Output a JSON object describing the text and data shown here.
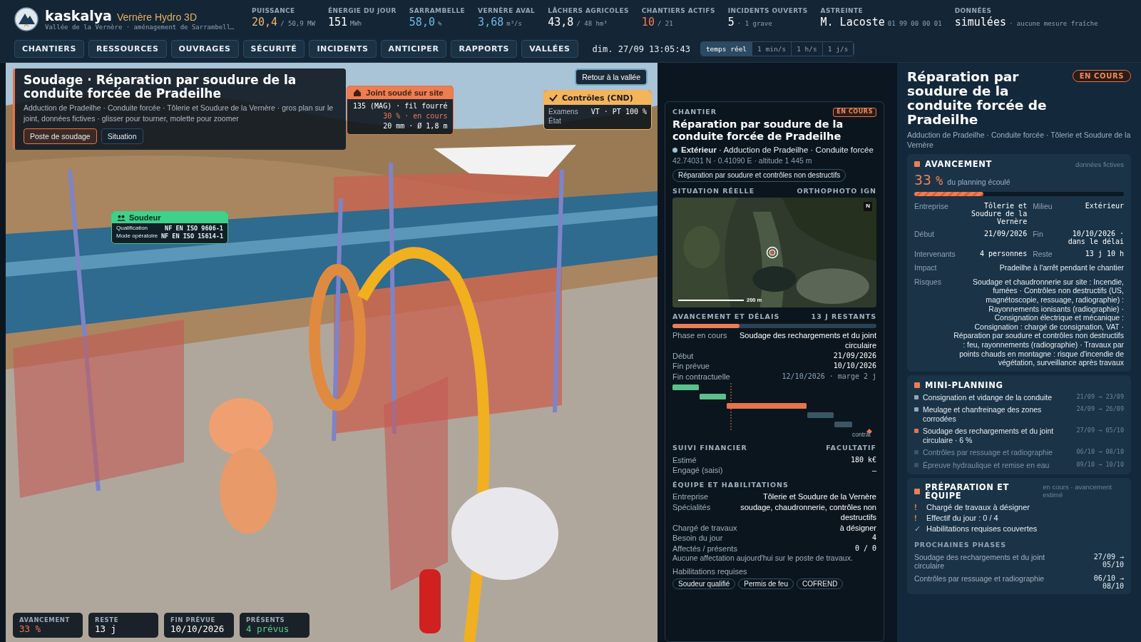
{
  "brand": {
    "name": "kaskalya",
    "product": "Vernère Hydro 3D",
    "subtitle": "Vallée de la Vernère · aménagement de Sarrambell…"
  },
  "kpis": [
    {
      "label": "PUISSANCE",
      "value": "20,4",
      "unit": "/ 50,9 MW",
      "color": "#f2b36b"
    },
    {
      "label": "ÉNERGIE DU JOUR",
      "value": "151",
      "unit": "MWh",
      "color": "#ffffff"
    },
    {
      "label": "SARRAMBELLE",
      "value": "58,0",
      "unit": "%",
      "color": "#6fb9e6"
    },
    {
      "label": "VERNÈRE AVAL",
      "value": "3,68",
      "unit": "m³/s",
      "color": "#6fb9e6"
    },
    {
      "label": "LÂCHERS AGRICOLES",
      "value": "43,8",
      "unit": "/ 48 hm³",
      "color": "#ffffff"
    },
    {
      "label": "CHANTIERS ACTIFS",
      "value": "10",
      "unit": "/ 21",
      "color": "#f07b55"
    },
    {
      "label": "INCIDENTS OUVERTS",
      "value": "5",
      "unit": "· 1 grave",
      "color": "#ffffff"
    },
    {
      "label": "ASTREINTE",
      "value": "M. Lacoste",
      "unit": "01 99 00 00 01",
      "color": "#ffffff"
    },
    {
      "label": "DONNÉES",
      "value": "simulées",
      "unit": "· aucune mesure fraîche",
      "color": "#ffffff"
    }
  ],
  "nav": {
    "tabs": [
      {
        "label": "CHANTIERS",
        "selected": false
      },
      {
        "label": "RESSOURCES",
        "selected": false
      },
      {
        "label": "OUVRAGES",
        "selected": false
      },
      {
        "label": "SÉCURITÉ",
        "selected": false
      },
      {
        "label": "INCIDENTS",
        "selected": false
      },
      {
        "label": "ANTICIPER",
        "selected": false
      },
      {
        "label": "RAPPORTS",
        "selected": false
      },
      {
        "label": "VALLÉES",
        "selected": false
      }
    ],
    "clock": "dim. 27/09 13:05:43",
    "speeds": [
      {
        "label": "temps réel",
        "selected": true
      },
      {
        "label": "1 min/s",
        "selected": false
      },
      {
        "label": "1 h/s",
        "selected": false
      },
      {
        "label": "1 j/s",
        "selected": false
      }
    ]
  },
  "scene": {
    "title_card": {
      "title": "Soudage · Réparation par soudure de la conduite forcée de Pradeilhe",
      "subtitle": "Adduction de Pradeilhe · Conduite forcée · Tôlerie et Soudure de la Vernère · gros plan sur le joint, données fictives · glisser pour tourner, molette pour zoomer",
      "buttons": [
        {
          "label": "Poste de soudage",
          "selected": true
        },
        {
          "label": "Situation",
          "selected": false
        }
      ]
    },
    "return_button": "Retour à la vallée",
    "weld_label": {
      "title": "Joint soudé sur site",
      "rows": [
        {
          "value": "135 (MAG) · fil fourré",
          "kind": "plain"
        },
        {
          "value": "30 % · en cours",
          "kind": "alert"
        },
        {
          "value": "20 mm · Ø 1,8 m",
          "kind": "plain"
        }
      ]
    },
    "control_label": {
      "title": "Contrôles (CND)",
      "rows": [
        {
          "label": "Examens",
          "value": "VT · PT 100 %"
        },
        {
          "label": "État"
        }
      ]
    },
    "welder_label": {
      "title": "Soudeur",
      "rows": [
        {
          "label": "Qualification",
          "value": "NF EN ISO 9606-1"
        },
        {
          "label": "Mode opératoire",
          "value": "NF EN ISO 15614-1"
        }
      ]
    },
    "stats": [
      {
        "label": "AVANCEMENT",
        "value": "33 %",
        "color": "#f07b55"
      },
      {
        "label": "RESTE",
        "value": "13 j",
        "color": "#ffffff"
      },
      {
        "label": "FIN PRÉVUE",
        "value": "10/10/2026",
        "color": "#ffffff"
      },
      {
        "label": "PRÉSENTS",
        "value": "4 prévus",
        "color": "#4fd18b"
      }
    ]
  },
  "site_card": {
    "section": "CHANTIER",
    "badge": "EN COURS",
    "title": "Réparation par soudure de la conduite forcée de Pradeilhe",
    "location": "**Extérieur** · Adduction de Pradeilhe · Conduite forcée",
    "coords": "42.74031 N · 0.41090 E · altitude 1 445 m",
    "tag": "Réparation par soudure et contrôles non destructifs",
    "map": {
      "heading": "SITUATION RÉELLE",
      "source": "ORTHOPHOTO IGN",
      "north": "N",
      "scale": "200 m"
    },
    "progress": {
      "heading": "AVANCEMENT ET DÉLAIS",
      "remaining": "13 J RESTANTS",
      "level": 0.33,
      "rows": [
        {
          "label": "Phase en cours",
          "value": "Soudage des rechargements et du joint circulaire",
          "kind": "text"
        },
        {
          "label": "Début",
          "value": "21/09/2026",
          "kind": "date"
        },
        {
          "label": "Fin prévue",
          "value": "10/10/2026",
          "kind": "date"
        },
        {
          "label": "Fin contractuelle",
          "value": "12/10/2026 · marge 2 j",
          "kind": "muted"
        }
      ],
      "contract_label": "contrat"
    },
    "finance": {
      "heading": "SUIVI FINANCIER",
      "note": "FACULTATIF",
      "rows": [
        {
          "label": "Estimé",
          "value": "180 k€",
          "kind": "date"
        },
        {
          "label": "Engagé (saisi)",
          "value": "–",
          "kind": "text"
        }
      ]
    },
    "team": {
      "heading": "ÉQUIPE ET HABILITATIONS",
      "rows": [
        {
          "label": "Entreprise",
          "value": "Tôlerie et Soudure de la Vernère",
          "kind": "text"
        },
        {
          "label": "Spécialités",
          "value": "soudage, chaudronnerie, contrôles non destructifs",
          "kind": "text"
        },
        {
          "label": "Chargé de travaux",
          "value": "à désigner",
          "kind": "text"
        },
        {
          "label": "Besoin du jour",
          "value": "4",
          "kind": "date"
        },
        {
          "label": "Affectés / présents",
          "value": "0 / 0",
          "kind": "date"
        }
      ],
      "note": "Aucune affectation aujourd'hui sur le poste de travaux.",
      "habilitations_label": "Habilitations requises",
      "chips": [
        "Soudeur qualifié",
        "Permis de feu",
        "COFREND"
      ]
    }
  },
  "detail_panel": {
    "title": "Réparation par soudure de la conduite forcée de Pradeilhe",
    "badge": "EN COURS",
    "subtitle": "Adduction de Pradeilhe · Conduite forcée · Tôlerie et Soudure de la Vernère",
    "progress": {
      "heading": "AVANCEMENT",
      "note": "données fictives",
      "percent": "33",
      "unit": "%",
      "caption": "du planning écoulé",
      "level": 0.33,
      "facts": [
        {
          "label": "Entreprise",
          "value": "Tôlerie et Soudure de la Vernère"
        },
        {
          "label": "Milieu",
          "value": "Extérieur"
        },
        {
          "label": "Début",
          "value": "21/09/2026"
        },
        {
          "label": "Fin",
          "value": "10/10/2026 · dans le délai"
        },
        {
          "label": "Intervenants",
          "value": "4 personnes"
        },
        {
          "label": "Reste",
          "value": "13 j 10 h"
        }
      ],
      "wide_facts": [
        {
          "label": "Impact",
          "value": "Pradeilhe à l'arrêt pendant le chantier"
        },
        {
          "label": "Risques",
          "value": "Soudage et chaudronnerie sur site : Incendie, fumées · Contrôles non destructifs (US, magnétoscopie, ressuage, radiographie) : Rayonnements ionisants (radiographie) · Consignation électrique et mécanique : Consignation : chargé de consignation, VAT · Réparation par soudure et contrôles non destructifs : feu, rayonnements (radiographie) · Travaux par points chauds en montagne : risque d'incendie de végétation, surveillance après travaux"
        }
      ]
    },
    "planning": {
      "heading": "MINI-PLANNING",
      "items": [
        {
          "label": "Consignation et vidange de la conduite",
          "dates": "21/09 → 23/09",
          "color": "#8fa9b8",
          "dimmed": false
        },
        {
          "label": "Meulage et chanfreinage des zones corrodées",
          "dates": "24/09 → 26/09",
          "color": "#8fa9b8",
          "dimmed": false
        },
        {
          "label": "Soudage des rechargements et du joint circulaire · 6 %",
          "dates": "27/09 → 05/10",
          "color": "#e8734a",
          "dimmed": false
        },
        {
          "label": "Contrôles par ressuage et radiographie",
          "dates": "06/10 → 08/10",
          "color": "#3a5566",
          "dimmed": true
        },
        {
          "label": "Épreuve hydraulique et remise en eau",
          "dates": "09/10 → 10/10",
          "color": "#3a5566",
          "dimmed": true
        }
      ]
    },
    "preparation": {
      "heading": "PRÉPARATION ET ÉQUIPE",
      "note": "en cours · avancement estimé",
      "checks": [
        {
          "kind": "warning",
          "mark": "!",
          "label": "Chargé de travaux à désigner"
        },
        {
          "kind": "warning",
          "mark": "!",
          "label": "Effectif du jour : 0 / 4"
        },
        {
          "kind": "ok",
          "mark": "✓",
          "label": "Habilitations requises couvertes"
        }
      ],
      "phases_heading": "PROCHAINES PHASES",
      "phases": [
        {
          "label": "Soudage des rechargements et du joint circulaire",
          "dates": "27/09 → 05/10"
        },
        {
          "label": "Contrôles par ressuage et radiographie",
          "dates": "06/10 → 08/10"
        }
      ]
    }
  }
}
